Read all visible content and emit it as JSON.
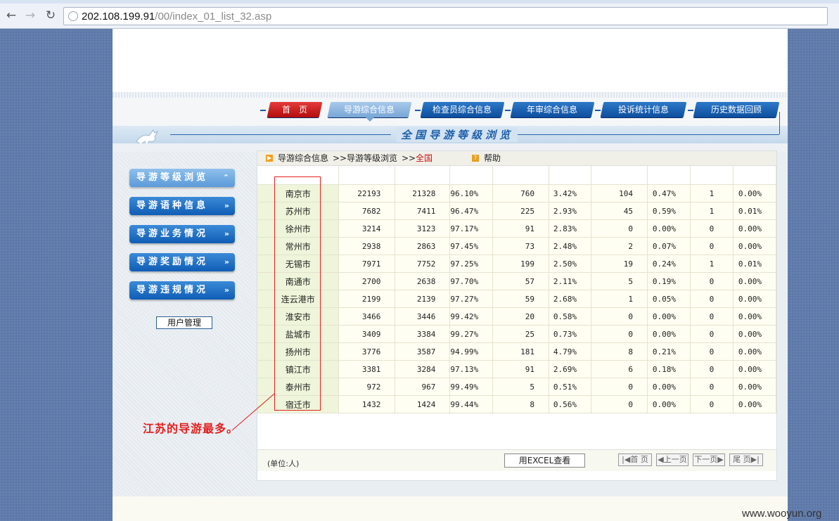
{
  "browser": {
    "url_host": "202.108.199.91",
    "url_path": "/00/index_01_list_32.asp"
  },
  "nav": {
    "tabs": [
      {
        "label": "首　页",
        "style": "home"
      },
      {
        "label": "导游综合信息",
        "style": "active"
      },
      {
        "label": "检查员综合信息",
        "style": "norm"
      },
      {
        "label": "年审综合信息",
        "style": "norm"
      },
      {
        "label": "投诉统计信息",
        "style": "norm"
      },
      {
        "label": "历史数据回顾",
        "style": "norm"
      }
    ]
  },
  "page_title": "全国导游等级浏览",
  "sidebar": {
    "items": [
      {
        "label": "导游等级浏览",
        "icon": "chevron-up-icon",
        "glyph": "⌃"
      },
      {
        "label": "导游语种信息",
        "icon": "double-chevron-right-icon",
        "glyph": "»"
      },
      {
        "label": "导游业务情况",
        "icon": "double-chevron-right-icon",
        "glyph": "»"
      },
      {
        "label": "导游奖励情况",
        "icon": "double-chevron-right-icon",
        "glyph": "»"
      },
      {
        "label": "导游违规情况",
        "icon": "double-chevron-right-icon",
        "glyph": "»"
      }
    ],
    "user_mgmt": "用户管理"
  },
  "breadcrumb": {
    "part1": "导游综合信息",
    "sep1": ">>",
    "part2": "导游等级浏览",
    "sep2": ">>",
    "current": "全国",
    "help": "帮助"
  },
  "table": {
    "rows": [
      [
        "南京市",
        "22193",
        "21328",
        "96.10%",
        "760",
        "3.42%",
        "104",
        "0.47%",
        "1",
        "0.00%"
      ],
      [
        "苏州市",
        "7682",
        "7411",
        "96.47%",
        "225",
        "2.93%",
        "45",
        "0.59%",
        "1",
        "0.01%"
      ],
      [
        "徐州市",
        "3214",
        "3123",
        "97.17%",
        "91",
        "2.83%",
        "0",
        "0.00%",
        "0",
        "0.00%"
      ],
      [
        "常州市",
        "2938",
        "2863",
        "97.45%",
        "73",
        "2.48%",
        "2",
        "0.07%",
        "0",
        "0.00%"
      ],
      [
        "无锡市",
        "7971",
        "7752",
        "97.25%",
        "199",
        "2.50%",
        "19",
        "0.24%",
        "1",
        "0.01%"
      ],
      [
        "南通市",
        "2700",
        "2638",
        "97.70%",
        "57",
        "2.11%",
        "5",
        "0.19%",
        "0",
        "0.00%"
      ],
      [
        "连云港市",
        "2199",
        "2139",
        "97.27%",
        "59",
        "2.68%",
        "1",
        "0.05%",
        "0",
        "0.00%"
      ],
      [
        "淮安市",
        "3466",
        "3446",
        "99.42%",
        "20",
        "0.58%",
        "0",
        "0.00%",
        "0",
        "0.00%"
      ],
      [
        "盐城市",
        "3409",
        "3384",
        "99.27%",
        "25",
        "0.73%",
        "0",
        "0.00%",
        "0",
        "0.00%"
      ],
      [
        "扬州市",
        "3776",
        "3587",
        "94.99%",
        "181",
        "4.79%",
        "8",
        "0.21%",
        "0",
        "0.00%"
      ],
      [
        "镇江市",
        "3381",
        "3284",
        "97.13%",
        "91",
        "2.69%",
        "6",
        "0.18%",
        "0",
        "0.00%"
      ],
      [
        "泰州市",
        "972",
        "967",
        "99.49%",
        "5",
        "0.51%",
        "0",
        "0.00%",
        "0",
        "0.00%"
      ],
      [
        "宿迁市",
        "1432",
        "1424",
        "99.44%",
        "8",
        "0.56%",
        "0",
        "0.00%",
        "0",
        "0.00%"
      ]
    ]
  },
  "footer": {
    "unit": "(单位:人)",
    "excel": "用EXCEL查看",
    "first": "首 页",
    "prev": "上一页",
    "next": "下一页",
    "last": "尾 页"
  },
  "annotation": "江苏的导游最多。",
  "watermark": "www.wooyun.org",
  "colors": {
    "accent": "#1f5fa9",
    "highlight": "#e41f1f",
    "home_tab": "#c81818"
  }
}
